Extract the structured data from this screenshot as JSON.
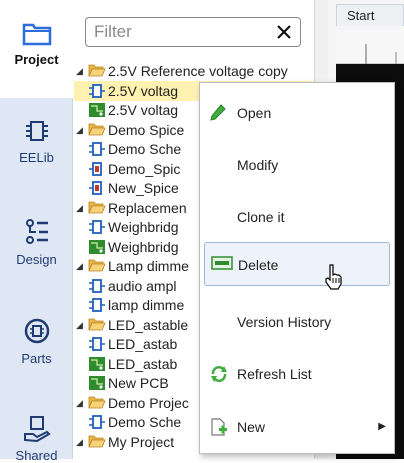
{
  "sidenav": {
    "items": [
      {
        "label": "Project",
        "icon": "folder-icon",
        "active": true
      },
      {
        "label": "EELib",
        "icon": "chip-icon"
      },
      {
        "label": "Design",
        "icon": "design-list-icon"
      },
      {
        "label": "Parts",
        "icon": "parts-icon"
      },
      {
        "label": "Shared",
        "icon": "shared-hand-icon"
      }
    ]
  },
  "filter": {
    "placeholder": "Filter",
    "value": ""
  },
  "tree": {
    "rows": [
      {
        "text": "2.5V Reference voltage copy",
        "kind": "folder",
        "open": true
      },
      {
        "text": "2.5V voltag",
        "kind": "schematic"
      },
      {
        "text": "2.5V voltag",
        "kind": "pcb"
      },
      {
        "text": "Demo Spice",
        "kind": "folder",
        "open": true
      },
      {
        "text": "Demo Sche",
        "kind": "schematic"
      },
      {
        "text": "Demo_Spic",
        "kind": "spice"
      },
      {
        "text": "New_Spice",
        "kind": "spice"
      },
      {
        "text": "Replacemen",
        "kind": "folder",
        "open": true
      },
      {
        "text": "Weighbridg",
        "kind": "schematic"
      },
      {
        "text": "Weighbridg",
        "kind": "pcb"
      },
      {
        "text": "Lamp dimme",
        "kind": "folder",
        "open": true
      },
      {
        "text": "audio ampl",
        "kind": "schematic"
      },
      {
        "text": "lamp dimme",
        "kind": "schematic"
      },
      {
        "text": "LED_astable",
        "kind": "folder",
        "open": true
      },
      {
        "text": "LED_astab",
        "kind": "schematic"
      },
      {
        "text": "LED_astab",
        "kind": "pcb"
      },
      {
        "text": "New PCB",
        "kind": "pcb"
      },
      {
        "text": "Demo Projec",
        "kind": "folder",
        "open": true
      },
      {
        "text": "Demo Sche",
        "kind": "schematic"
      },
      {
        "text": "My Project",
        "kind": "folder",
        "open": true
      }
    ]
  },
  "right": {
    "tab_label": "Start"
  },
  "context_menu": {
    "items": [
      {
        "label": "Open",
        "icon": "pencil-icon"
      },
      {
        "label": "Modify",
        "icon": ""
      },
      {
        "label": "Clone it",
        "icon": ""
      },
      {
        "label": "Delete",
        "icon": "delete-icon"
      },
      {
        "label": "Version History",
        "icon": ""
      },
      {
        "label": "Refresh List",
        "icon": "refresh-icon"
      },
      {
        "label": "New",
        "icon": "new-doc-icon",
        "submenu": true
      }
    ]
  },
  "colors": {
    "sidenav_bg": "#dfe7f5",
    "nav_text": "#1e3c72",
    "selected_row": "#fff1b0",
    "folder_yellow": "#f2c14e",
    "schematic_blue": "#1f5fbf",
    "pcb_green": "#2e8b2e",
    "menu_hover": "#eef3fb"
  }
}
